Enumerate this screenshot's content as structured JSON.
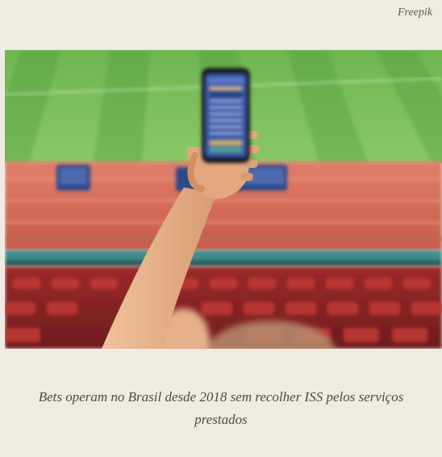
{
  "credit": "Freepik",
  "caption": "Bets operam no Brasil desde 2018 sem recolher ISS pelos serviços prestados",
  "photo": {
    "subject": "hand-holding-phone-stadium",
    "colors": {
      "grass_light": "#7fc15a",
      "grass_dark": "#5ea646",
      "track": "#d9735e",
      "seat": "#b8322e",
      "skin": "#e9b48a",
      "screen": "#3b58a8",
      "teal": "#3e8c8a"
    }
  }
}
